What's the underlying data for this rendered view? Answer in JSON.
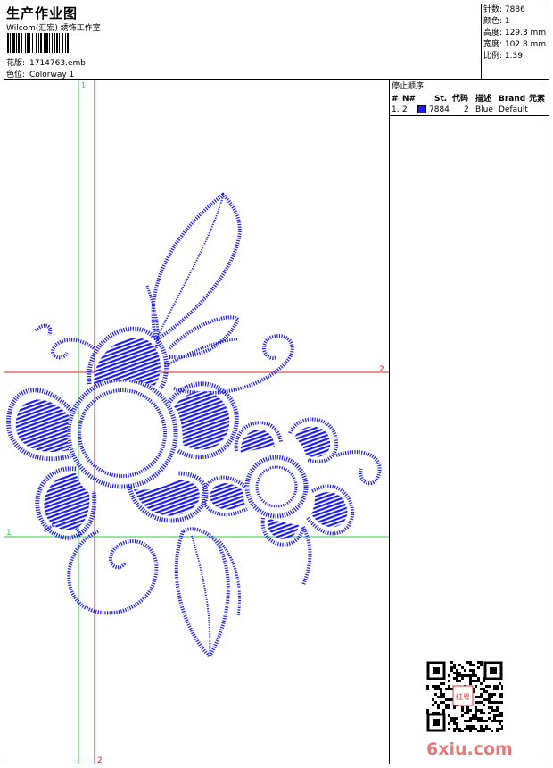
{
  "header": {
    "title": "生产作业图",
    "company": "Wilcom(汇宏) 绣饰工作室",
    "design_label": "花版:",
    "design_value": "1714763.emb",
    "colorway_label": "色位:",
    "colorway_value": "Colorway 1"
  },
  "stats": [
    {
      "label": "针数:",
      "value": "7886"
    },
    {
      "label": "颜色:",
      "value": "1"
    },
    {
      "label": "高度:",
      "value": "129.3 mm"
    },
    {
      "label": "宽度:",
      "value": "102.8 mm"
    },
    {
      "label": "比例:",
      "value": "1.39"
    }
  ],
  "sequence": {
    "title": "停止顺序:",
    "columns": [
      "#",
      "N#",
      "St.",
      "代码",
      "描述",
      "Brand",
      "元素"
    ],
    "rows": [
      {
        "num": "1.",
        "n": "2",
        "color": "#1a1aff",
        "stitch": "7884",
        "code": "2",
        "desc": "Blue",
        "brand": "Default"
      }
    ]
  },
  "canvas": {
    "guide_labels": [
      "1",
      "2",
      "2",
      "1"
    ],
    "thread_color": "#1a1aff",
    "guide_green": "#2ecc40",
    "guide_red": "#e02020"
  },
  "watermark": {
    "text": "6xiu.com",
    "stamp": "红粤"
  }
}
